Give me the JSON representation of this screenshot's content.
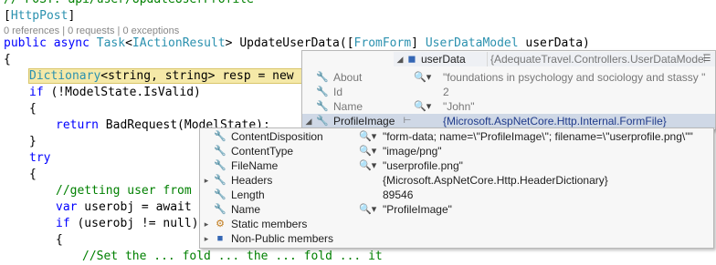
{
  "code": {
    "line0": "// POST: api/user/UpdateUserProfile",
    "attr": "HttpPost",
    "codelens": "0 references | 0 requests | 0 exceptions",
    "sig_public": "public",
    "sig_async": "async",
    "sig_task": "Task",
    "sig_iaction": "IActionResult",
    "sig_method": "UpdateUserData(",
    "sig_fromform": "FromForm",
    "sig_model": "UserDataModel",
    "sig_param": "userData)",
    "brace_open": "{",
    "dict_type": "Dictionary",
    "dict_generic": "<string, string>",
    "dict_rest": " resp = new D",
    "if_kw": "if",
    "if_rest": " (!ModelState.IsValid)",
    "brace2": "{",
    "return_kw": "return",
    "return_rest": " BadRequest(ModelState);",
    "brace3": "}",
    "try_kw": "try",
    "brace4": "{",
    "comment_getting": "//getting user from",
    "var_kw": "var",
    "var_rest": " userobj = await",
    "if2_kw": "if",
    "if2_rest": " (userobj != null)",
    "brace5": "{",
    "comment_last": "//Set the ... fold ... the ... fold ... it"
  },
  "tooltip_main": {
    "header_name": "userData",
    "header_value": "{AdequateTravel.Controllers.UserDataModel}",
    "rows": [
      {
        "name": "About",
        "value": "\"foundations in psychology and sociology and stassy \""
      },
      {
        "name": "Id",
        "value": "2"
      },
      {
        "name": "Name",
        "value": "\"John\""
      },
      {
        "name": "ProfileImage",
        "value": "{Microsoft.AspNetCore.Http.Internal.FormFile}"
      }
    ]
  },
  "tooltip_sub": {
    "rows": [
      {
        "name": "ContentDisposition",
        "value": "\"form-data; name=\\\"ProfileImage\\\"; filename=\\\"userprofile.png\\\"\""
      },
      {
        "name": "ContentType",
        "value": "\"image/png\""
      },
      {
        "name": "FileName",
        "value": "\"userprofile.png\""
      },
      {
        "name": "Headers",
        "value": "{Microsoft.AspNetCore.Http.HeaderDictionary}"
      },
      {
        "name": "Length",
        "value": "89546"
      },
      {
        "name": "Name",
        "value": "\"ProfileImage\""
      },
      {
        "name": "Static members",
        "value": ""
      },
      {
        "name": "Non-Public members",
        "value": ""
      }
    ]
  },
  "icons": {
    "wrench": "wrench-icon",
    "magnifier": "magnifier-icon",
    "pin": "pin-icon",
    "static": "static-members-icon",
    "nonpublic": "non-public-members-icon"
  }
}
